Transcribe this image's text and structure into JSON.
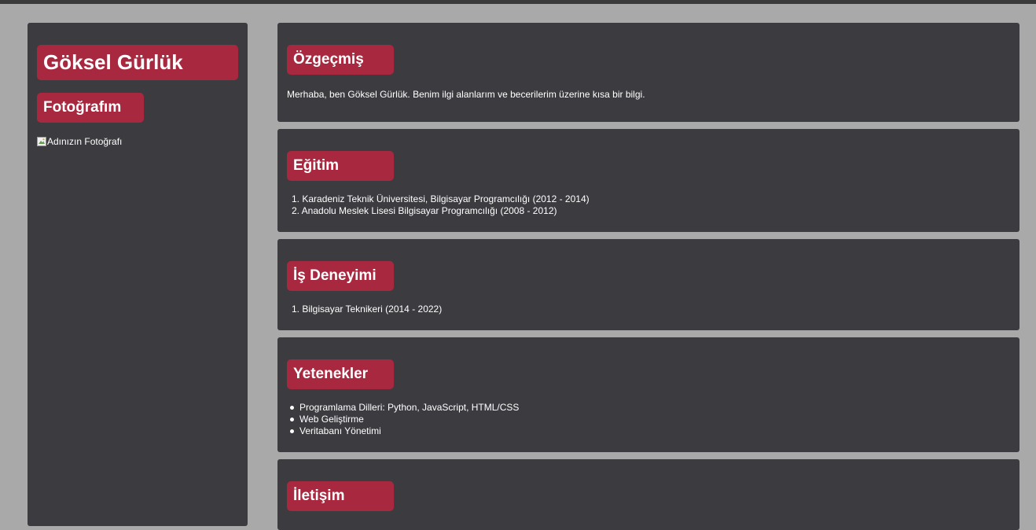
{
  "profile": {
    "name": "Göksel Gürlük",
    "photo_heading": "Fotoğrafım",
    "photo_alt": "Adınızın Fotoğrafı"
  },
  "sections": {
    "about": {
      "heading": "Özgeçmiş",
      "text": "Merhaba, ben Göksel Gürlük. Benim ilgi alanlarım ve becerilerim üzerine kısa bir bilgi."
    },
    "education": {
      "heading": "Eğitim",
      "items": [
        {
          "num": "1.",
          "text": "Karadeniz Teknik Üniversitesi, Bilgisayar Programcılığı (2012 - 2014)"
        },
        {
          "num": "2.",
          "text": "Anadolu Meslek Lisesi Bilgisayar Programcılığı (2008 - 2012)"
        }
      ]
    },
    "experience": {
      "heading": "İş Deneyimi",
      "items": [
        {
          "num": "1.",
          "text": "Bilgisayar Teknikeri (2014 - 2022)"
        }
      ]
    },
    "skills": {
      "heading": "Yetenekler",
      "items": [
        "Programlama Dilleri: Python, JavaScript, HTML/CSS",
        "Web Geliştirme",
        "Veritabanı Yönetimi"
      ]
    },
    "contact": {
      "heading": "İletişim"
    }
  },
  "colors": {
    "background": "#a9a9a9",
    "panel": "#3c3b40",
    "accent": "#a8283f",
    "text": "#ffffff"
  },
  "icons": {
    "photo_placeholder": "broken-image-icon"
  }
}
